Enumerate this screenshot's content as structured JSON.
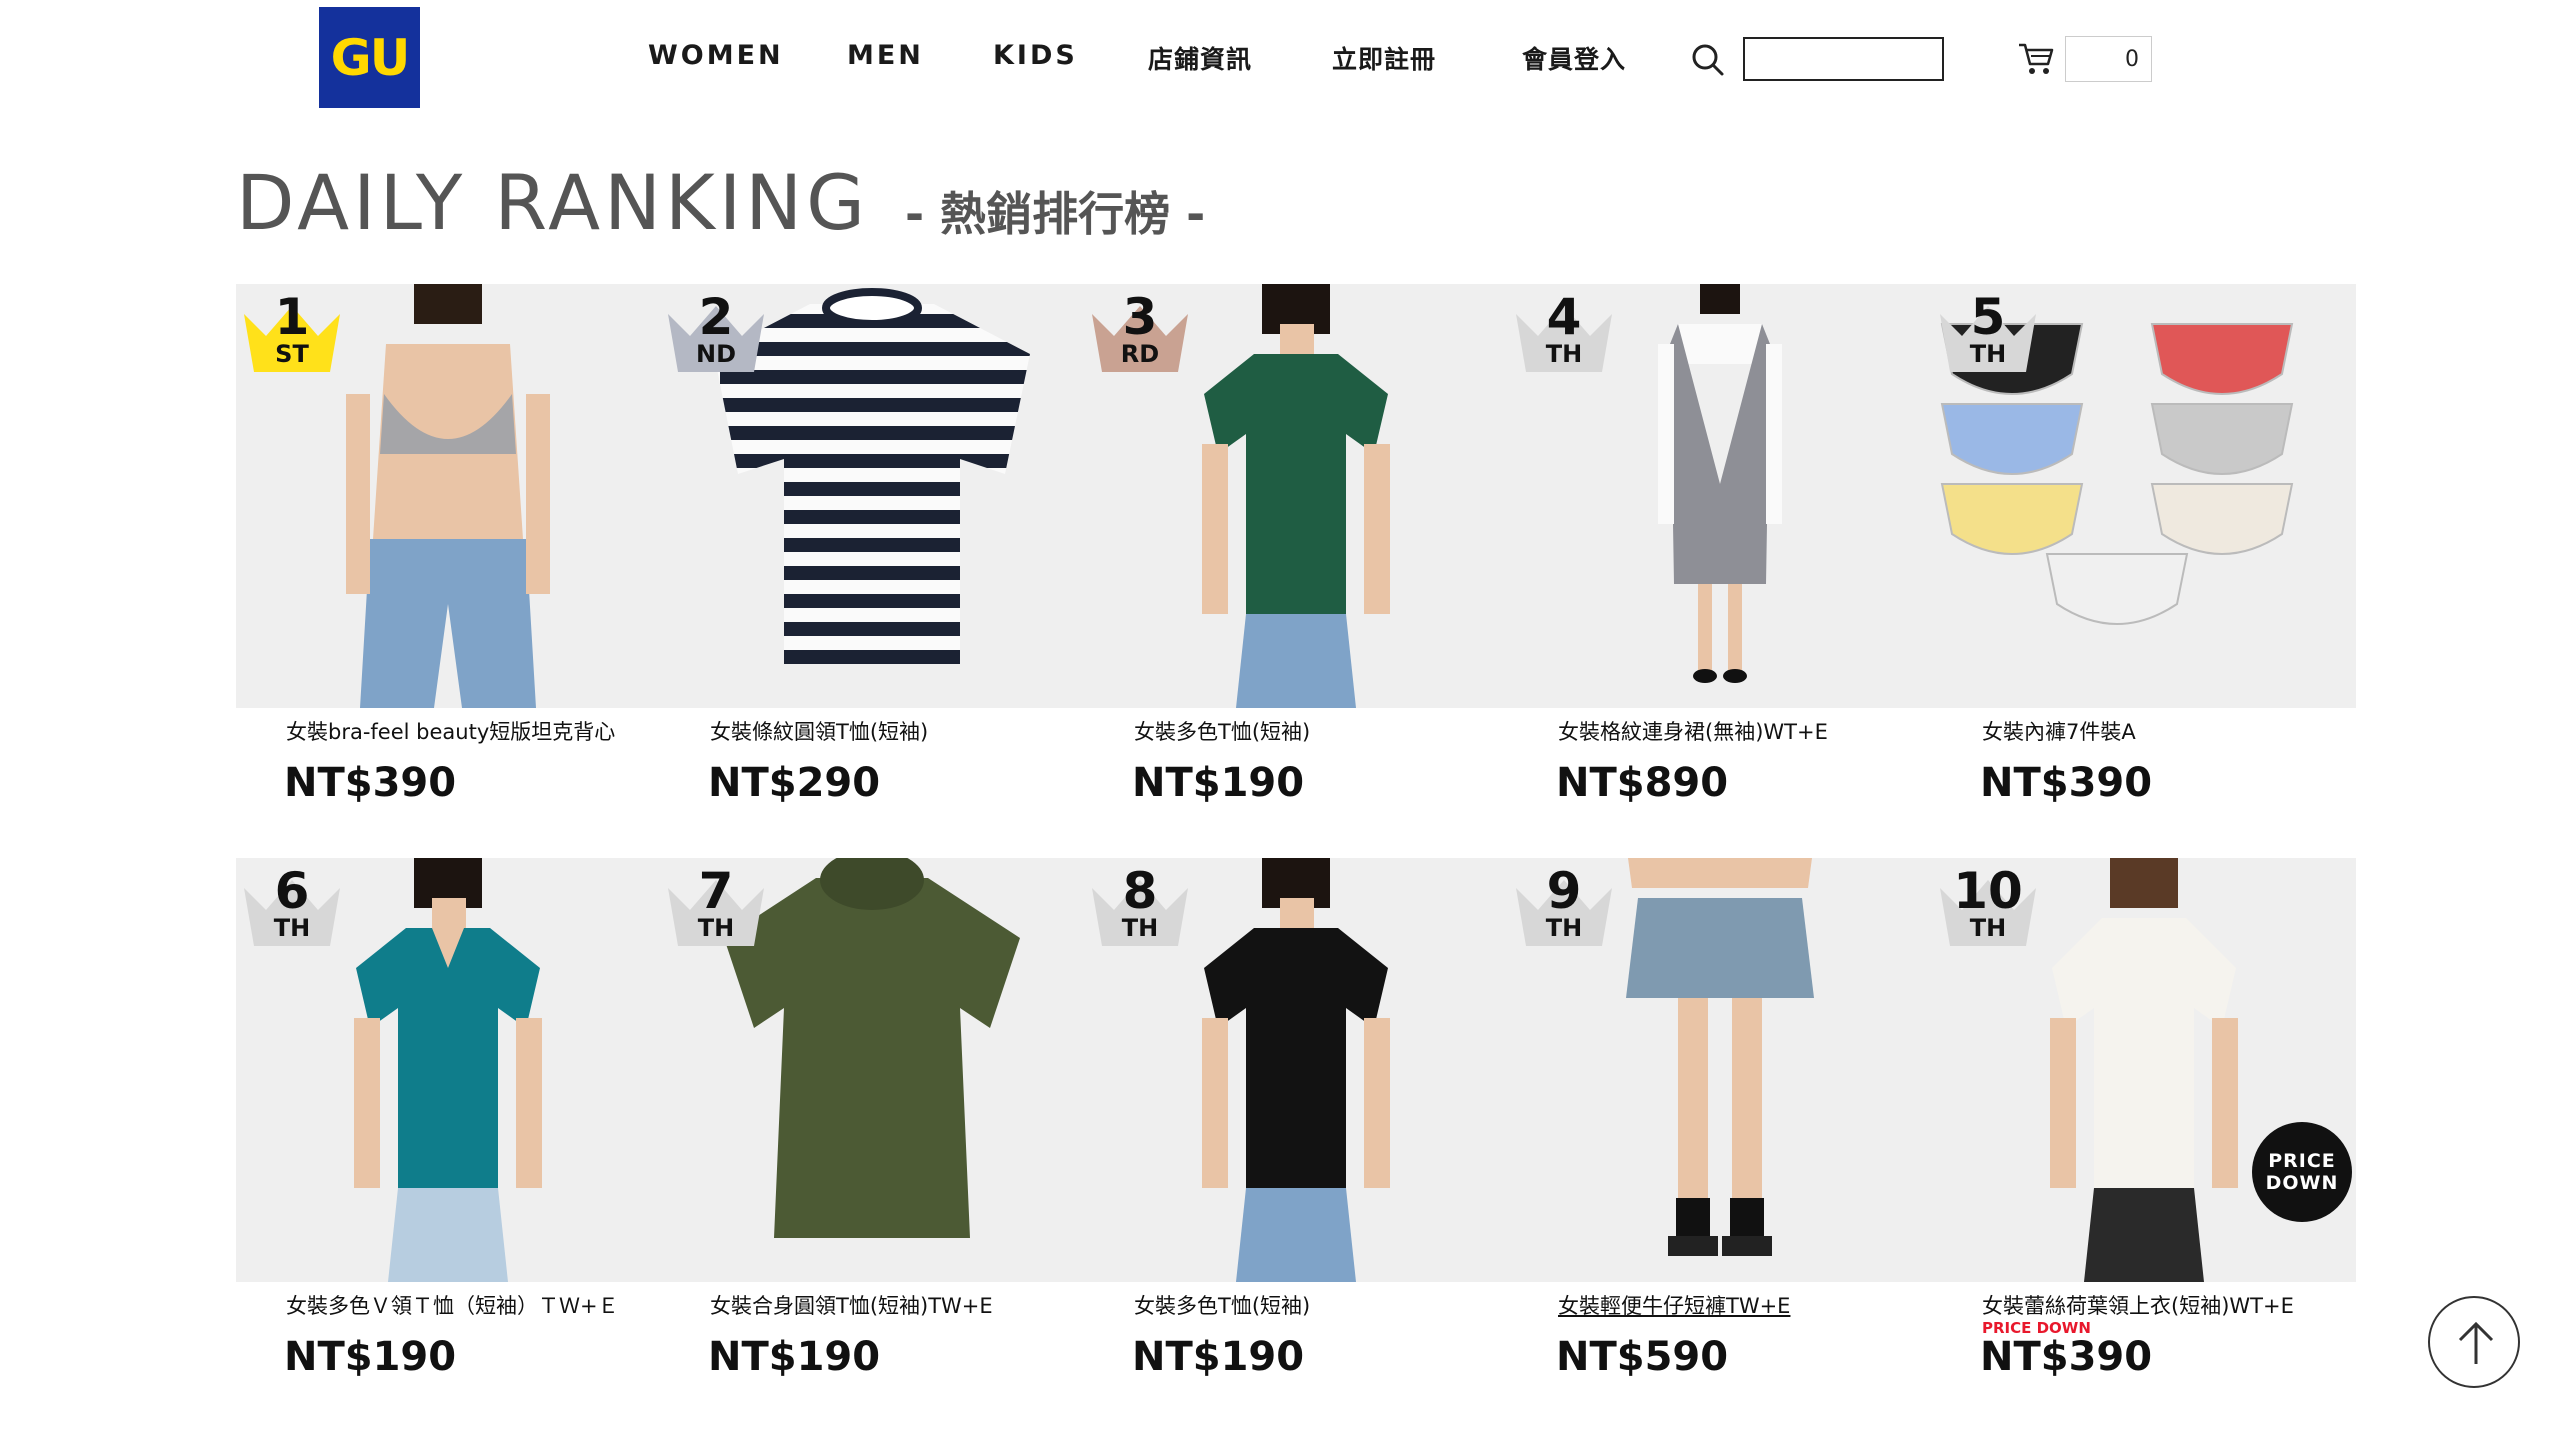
{
  "header": {
    "logo_text": "GU",
    "nav": [
      "WOMEN",
      "MEN",
      "KIDS",
      "店鋪資訊",
      "立即註冊",
      "會員登入"
    ],
    "search_value": "",
    "cart_count": "0"
  },
  "title": {
    "main": "DAILY RANKING",
    "sub": "- 熱銷排行榜 -"
  },
  "products": [
    {
      "rank": "1",
      "suffix": "ST",
      "name": "女裝bra-feel beauty短版坦克背心",
      "price": "NT$390",
      "crown": "#ffe11a",
      "image": "gray-bra-top-jeans"
    },
    {
      "rank": "2",
      "suffix": "ND",
      "name": "女裝條紋圓領T恤(短袖)",
      "price": "NT$290",
      "crown": "#b4b8c4",
      "image": "striped-tshirt"
    },
    {
      "rank": "3",
      "suffix": "RD",
      "name": "女裝多色T恤(短袖)",
      "price": "NT$190",
      "crown": "#c9a292",
      "image": "green-tshirt"
    },
    {
      "rank": "4",
      "suffix": "TH",
      "name": "女裝格紋連身裙(無袖)WT+E",
      "price": "NT$890",
      "crown": "#d7d7d7",
      "image": "plaid-dress"
    },
    {
      "rank": "5",
      "suffix": "TH",
      "name": "女裝內褲7件裝A",
      "price": "NT$390",
      "crown": "#d7d7d7",
      "image": "underwear-pack"
    },
    {
      "rank": "6",
      "suffix": "TH",
      "name": "女裝多色Ｖ領Ｔ恤（短袖）ＴＷ+Ｅ",
      "price": "NT$190",
      "crown": "#d7d7d7",
      "image": "teal-vneck"
    },
    {
      "rank": "7",
      "suffix": "TH",
      "name": "女裝合身圓領T恤(短袖)TW+E",
      "price": "NT$190",
      "crown": "#d7d7d7",
      "image": "olive-tshirt"
    },
    {
      "rank": "8",
      "suffix": "TH",
      "name": "女裝多色T恤(短袖)",
      "price": "NT$190",
      "crown": "#d7d7d7",
      "image": "black-tshirt"
    },
    {
      "rank": "9",
      "suffix": "TH",
      "name": "女裝輕便牛仔短褲TW+E",
      "price": "NT$590",
      "crown": "#d7d7d7",
      "image": "denim-skirt"
    },
    {
      "rank": "10",
      "suffix": "TH",
      "name": "女裝蕾絲荷葉領上衣(短袖)WT+E",
      "price": "NT$390",
      "crown": "#d7d7d7",
      "image": "lace-top",
      "price_down_label": "PRICE DOWN",
      "badge": "PRICE DOWN"
    }
  ],
  "back_to_top": "arrow-up-icon"
}
